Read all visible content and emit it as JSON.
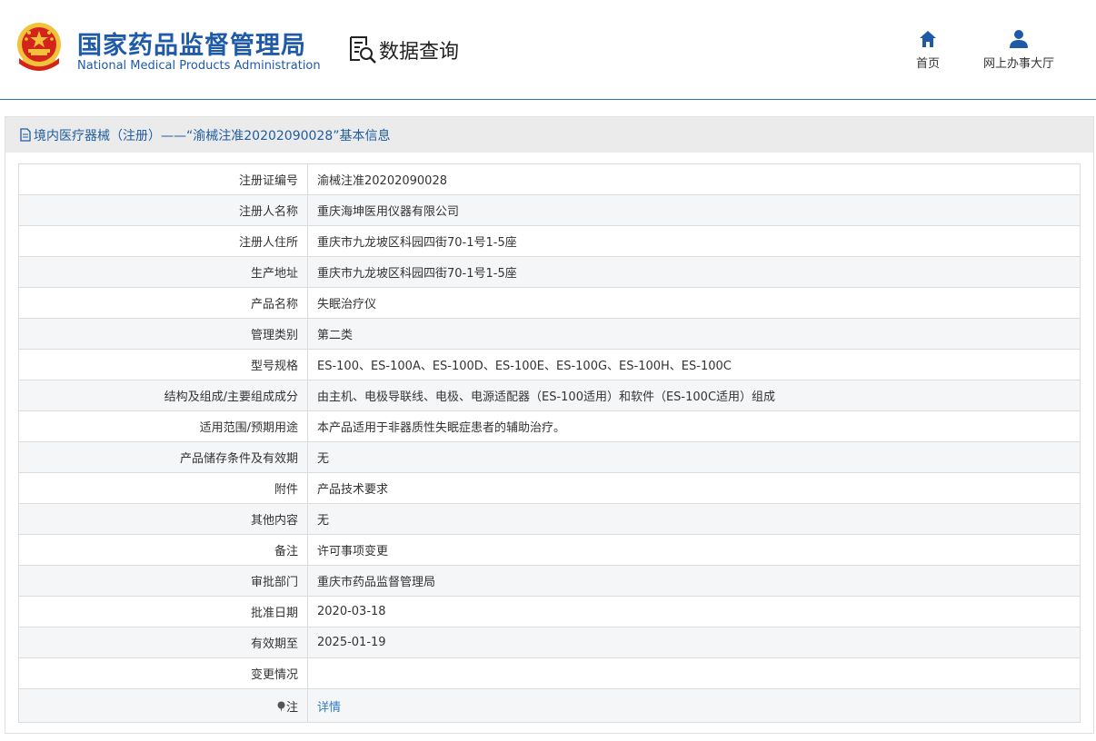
{
  "header": {
    "org_name_cn": "国家药品监督管理局",
    "org_name_en": "National Medical Products Administration",
    "search_title": "数据查询",
    "nav": {
      "home_label": "首页",
      "hall_label": "网上办事大厅"
    }
  },
  "panel": {
    "title": "境内医疗器械（注册）——“渝械注准20202090028”基本信息"
  },
  "rows": [
    {
      "label": "注册证编号",
      "value": "渝械注准20202090028"
    },
    {
      "label": "注册人名称",
      "value": "重庆海坤医用仪器有限公司"
    },
    {
      "label": "注册人住所",
      "value": "重庆市九龙坡区科园四街70-1号1-5座"
    },
    {
      "label": "生产地址",
      "value": "重庆市九龙坡区科园四街70-1号1-5座"
    },
    {
      "label": "产品名称",
      "value": "失眠治疗仪"
    },
    {
      "label": "管理类别",
      "value": "第二类"
    },
    {
      "label": "型号规格",
      "value": "ES-100、ES-100A、ES-100D、ES-100E、ES-100G、ES-100H、ES-100C"
    },
    {
      "label": "结构及组成/主要组成成分",
      "value": "由主机、电极导联线、电极、电源适配器（ES-100适用）和软件（ES-100C适用）组成"
    },
    {
      "label": "适用范围/预期用途",
      "value": "本产品适用于非器质性失眠症患者的辅助治疗。"
    },
    {
      "label": "产品储存条件及有效期",
      "value": "无"
    },
    {
      "label": "附件",
      "value": "产品技术要求"
    },
    {
      "label": "其他内容",
      "value": "无"
    },
    {
      "label": "备注",
      "value": "许可事项变更"
    },
    {
      "label": "审批部门",
      "value": "重庆市药品监督管理局"
    },
    {
      "label": "批准日期",
      "value": "2020-03-18"
    },
    {
      "label": "有效期至",
      "value": "2025-01-19"
    },
    {
      "label": "变更情况",
      "value": ""
    }
  ],
  "note_row": {
    "label": "注",
    "link": "详情"
  },
  "colors": {
    "brand_blue": "#1e5aa8",
    "link_blue": "#2f7cc0",
    "emblem_red": "#d4231a",
    "emblem_gold": "#f2c23a"
  },
  "icons": {
    "emblem": "national-emblem-icon",
    "search": "document-search-icon",
    "home": "home-icon",
    "hall": "user-icon",
    "panel": "document-icon",
    "note": "pin-icon"
  }
}
